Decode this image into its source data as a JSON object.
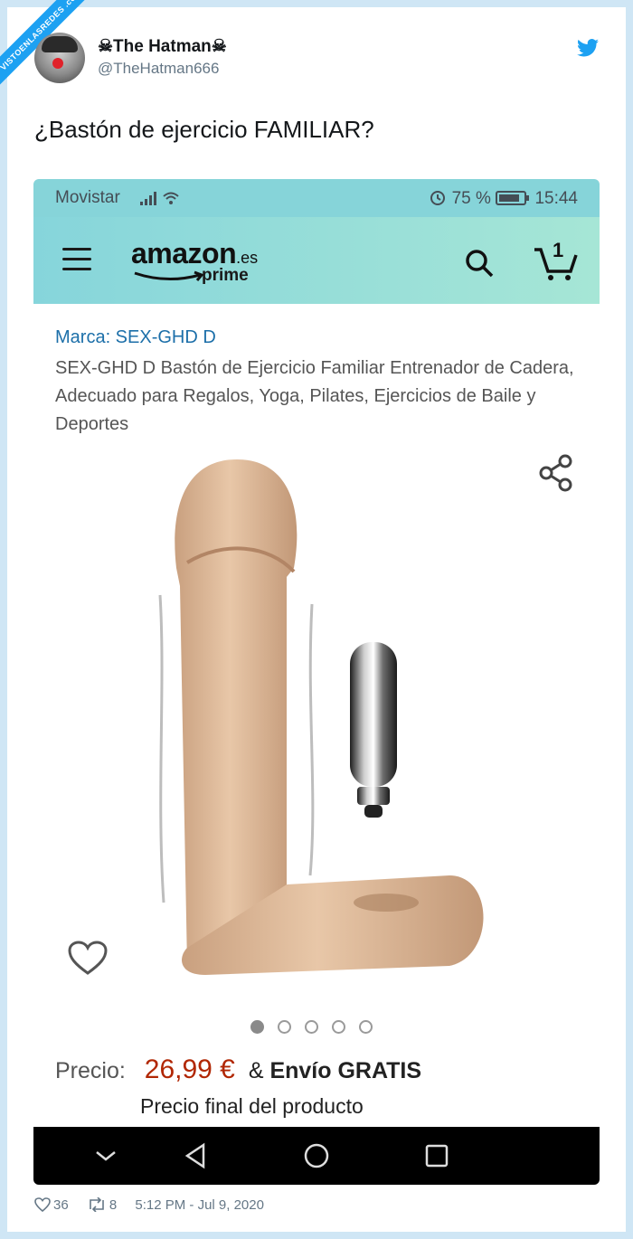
{
  "watermark": "VISTOENLASREDES .com",
  "tweet": {
    "user_name": "☠The Hatman☠",
    "user_handle": "@TheHatman666",
    "text": "¿Bastón de ejercicio FAMILIAR?",
    "likes": "36",
    "retweets": "8",
    "timestamp": "5:12 PM - Jul 9, 2020"
  },
  "screenshot": {
    "status_bar": {
      "carrier": "Movistar",
      "battery_text": "75 %",
      "time": "15:44"
    },
    "app_bar": {
      "logo_word": "amazon",
      "logo_domain": ".es",
      "logo_sub": "prime",
      "cart_count": "1"
    },
    "product": {
      "brand": "Marca: SEX-GHD D",
      "title": "SEX-GHD D Bastón de Ejercicio Familiar Entrenador de Cadera, Adecuado para Regalos, Yoga, Pilates, Ejercicios de Baile y Deportes",
      "image_count": 5,
      "active_image": 1,
      "price_label": "Precio:",
      "price_value": "26,99 €",
      "shipping_prefix": "&",
      "shipping_text": "Envío GRATIS",
      "price_note": "Precio final del producto"
    }
  },
  "colors": {
    "status_bar": "#86d4d9",
    "link": "#1c6fa9",
    "price": "#b12704",
    "twitter_blue": "#1da1f2"
  },
  "icons": [
    "twitter-bird-icon",
    "menu-icon",
    "search-icon",
    "cart-icon",
    "share-icon",
    "heart-icon",
    "nav-back-icon",
    "nav-home-icon",
    "nav-recents-icon",
    "nav-collapse-icon",
    "like-icon",
    "retweet-icon",
    "signal-icon",
    "wifi-icon",
    "alarm-icon",
    "battery-icon"
  ]
}
